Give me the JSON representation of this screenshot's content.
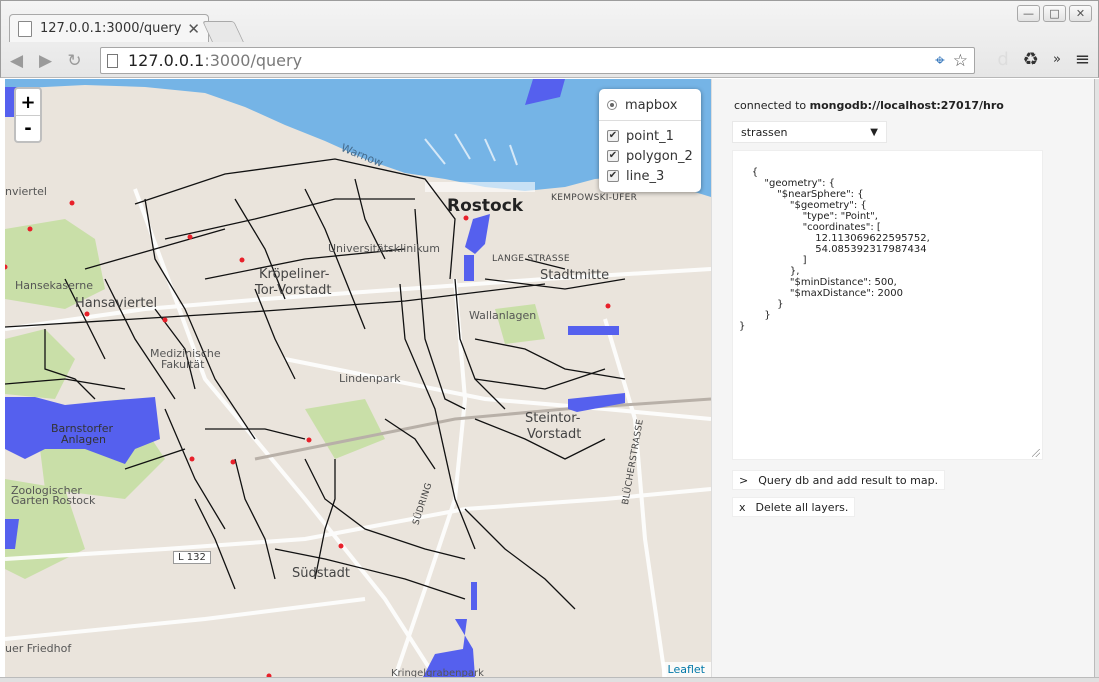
{
  "browser": {
    "tab_title": "127.0.0.1:3000/query",
    "tab_close": "✕",
    "url_host": "127.0.0.1",
    "url_path": ":3000/query",
    "window_buttons": [
      "—",
      "□",
      "✕"
    ]
  },
  "map": {
    "zoom_in": "+",
    "zoom_out": "-",
    "layers": {
      "base": "mapbox",
      "overlays": [
        "point_1",
        "polygon_2",
        "line_3"
      ],
      "check_mark": "✔"
    },
    "attribution": "Leaflet",
    "labels": {
      "rostock": "Rostock",
      "kempowski": "KEMPOWSKI-UFER",
      "warnow": "Warnow",
      "universitaet": "Universitätsklinikum",
      "kroepeliner1": "Kröpeliner-",
      "kroepeliner2": "Tor-Vorstadt",
      "lange_strasse": "LANGE STRASSE",
      "stadtmitte": "Stadtmitte",
      "hanseviertel": "Hansaviertel",
      "hansekaserne": "Hansekaserne",
      "medizinische1": "Medizinische",
      "medizinische2": "Fakultät",
      "wallanlagen": "Wallanlagen",
      "lindenpark": "Lindenpark",
      "steintor1": "Steintor-",
      "steintor2": "Vorstadt",
      "barnstorfer1": "Barnstorfer",
      "barnstorfer2": "Anlagen",
      "zoo1": "Zoologischer",
      "zoo2": "Garten Rostock",
      "suedring": "SÜDRING",
      "bluecher": "BLÜCHERSTRASSE",
      "l132": "L 132",
      "suedstadt": "Südstadt",
      "neuer_friedhof": "uer Friedhof",
      "kringelgraben": "Kringelgrabenpark",
      "nviertel": "nviertel"
    }
  },
  "panel": {
    "connected_prefix": "connected to ",
    "connected_db": "mongodb://localhost:27017/hro",
    "collection_select": "strassen",
    "select_arrow": "▼",
    "query_text": "{\n        \"geometry\": {\n            \"$nearSphere\": {\n                \"$geometry\": {\n                    \"type\": \"Point\",\n                    \"coordinates\": [\n                        12.113069622595752,\n                        54.085392317987434\n                    ]\n                },\n                \"$minDistance\": 500,\n                \"$maxDistance\": 2000\n            }\n        }\n}",
    "query_button": {
      "symbol": ">",
      "label": "Query db and add result to map."
    },
    "delete_button": {
      "symbol": "x",
      "label": "Delete all layers."
    }
  },
  "colors": {
    "water": "#75b4e6",
    "polygon": "#5560ee",
    "point": "#e8202a",
    "line": "#111111",
    "park": "#c9dfa8"
  }
}
